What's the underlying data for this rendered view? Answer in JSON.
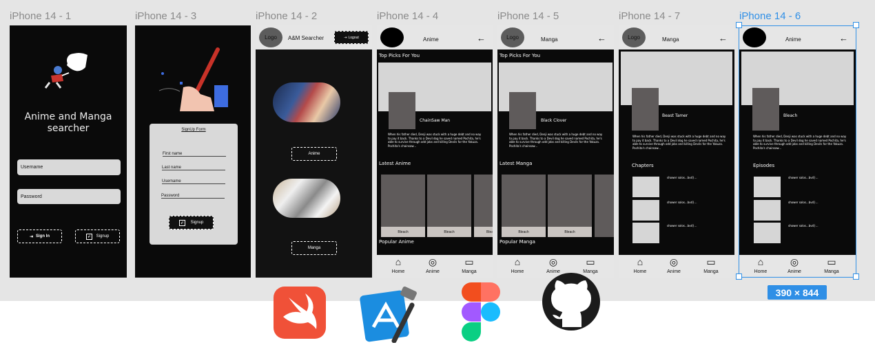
{
  "frames": {
    "f1": {
      "title": "iPhone 14 - 1",
      "app_title": "Anime and Manga searcher",
      "username": "Username",
      "password": "Password",
      "signin": "Sign In",
      "signup": "Signup"
    },
    "f3": {
      "title": "iPhone 14 - 3",
      "form_title": "SignUp Form",
      "first": "First name",
      "last": "Last name",
      "user": "Username",
      "pass": "Password",
      "signup": "Signup"
    },
    "f2": {
      "title": "iPhone 14 - 2",
      "logo": "Logo",
      "app": "A&M Searcher",
      "logout": "Logout",
      "anime": "Anime",
      "manga": "Manga"
    },
    "f4": {
      "title": "iPhone 14 - 4",
      "header": "Anime",
      "top_picks": "Top Picks For You",
      "featured": "ChainSaw Man",
      "desc": "When his father died, Denji was stuck with a huge debt and no way to pay it back. Thanks to a Devil dog he saved named Pochita, he's able to survive through odd jobs and killing Devils for the Yakuza. Pochita's chainsaw...",
      "latest": "Latest Anime",
      "card": "Bleach",
      "popular": "Popular Anime"
    },
    "f5": {
      "title": "iPhone 14 - 5",
      "logo": "Logo",
      "header": "Manga",
      "top_picks": "Top Picks For You",
      "featured": "Black Clover",
      "desc": "When his father died, Denji was stuck with a huge debt and no way to pay it back. Thanks to a Devil dog he saved named Pochita, he's able to survive through odd jobs and killing Devils for the Yakuza. Pochita's chainsaw...",
      "latest": "Latest Manga",
      "card": "Bleach",
      "popular": "Popular Manga"
    },
    "f7": {
      "title": "iPhone 14 - 7",
      "logo": "Logo",
      "header": "Manga",
      "featured": "Beast Tamer",
      "desc": "When his father died, Denji was stuck with a huge debt and no way to pay it back. Thanks to a Devil dog he saved named Pochita, he's able to survive through odd jobs and killing Devils for the Yakuza. Pochita's chainsaw...",
      "section": "Chapters",
      "item": "shower solos...bvd}..."
    },
    "f6": {
      "title": "iPhone 14 - 6",
      "header": "Anime",
      "featured": "Bleach",
      "desc": "When his father died, Denji was stuck with a huge debt and no way to pay it back. Thanks to a Devil dog he saved named Pochita, he's able to survive through odd jobs and killing Devils for the Yakuza. Pochita's chainsaw...",
      "section": "Episodes",
      "item": "shower solos...bvd}..."
    }
  },
  "nav": {
    "home": "Home",
    "anime": "Anime",
    "manga": "Manga"
  },
  "selection": {
    "size": "390 × 844",
    "accent": "#2f8fe6"
  },
  "tools": [
    "swift-icon",
    "xcode-icon",
    "figma-icon",
    "github-icon"
  ]
}
